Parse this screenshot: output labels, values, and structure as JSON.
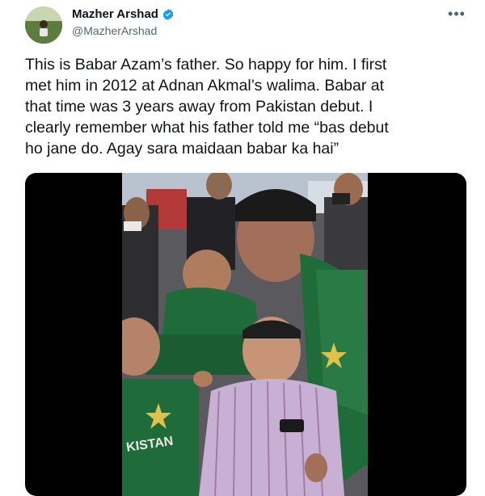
{
  "author": {
    "display_name": "Mazher Arshad",
    "handle": "@MazherArshad",
    "verified": true
  },
  "menu": {
    "more_icon": "more-horizontal-icon",
    "more_glyph": "•••"
  },
  "tweet": {
    "text_lines": [
      "This is Babar Azam’s father. So happy for him. I first",
      "met him in 2012 at Adnan Akmal’s walima. Babar at",
      "that time was 3 years away from Pakistan debut. I",
      "clearly remember what his father told me “bas debut",
      "ho jane do. Agay sara maidaan babar ka hai”"
    ]
  },
  "media": {
    "shirt_text": "KISTAN"
  },
  "colors": {
    "verified_blue": "#1d9bf0",
    "secondary_text": "#536471",
    "jersey_green": "#1f6b3a"
  }
}
